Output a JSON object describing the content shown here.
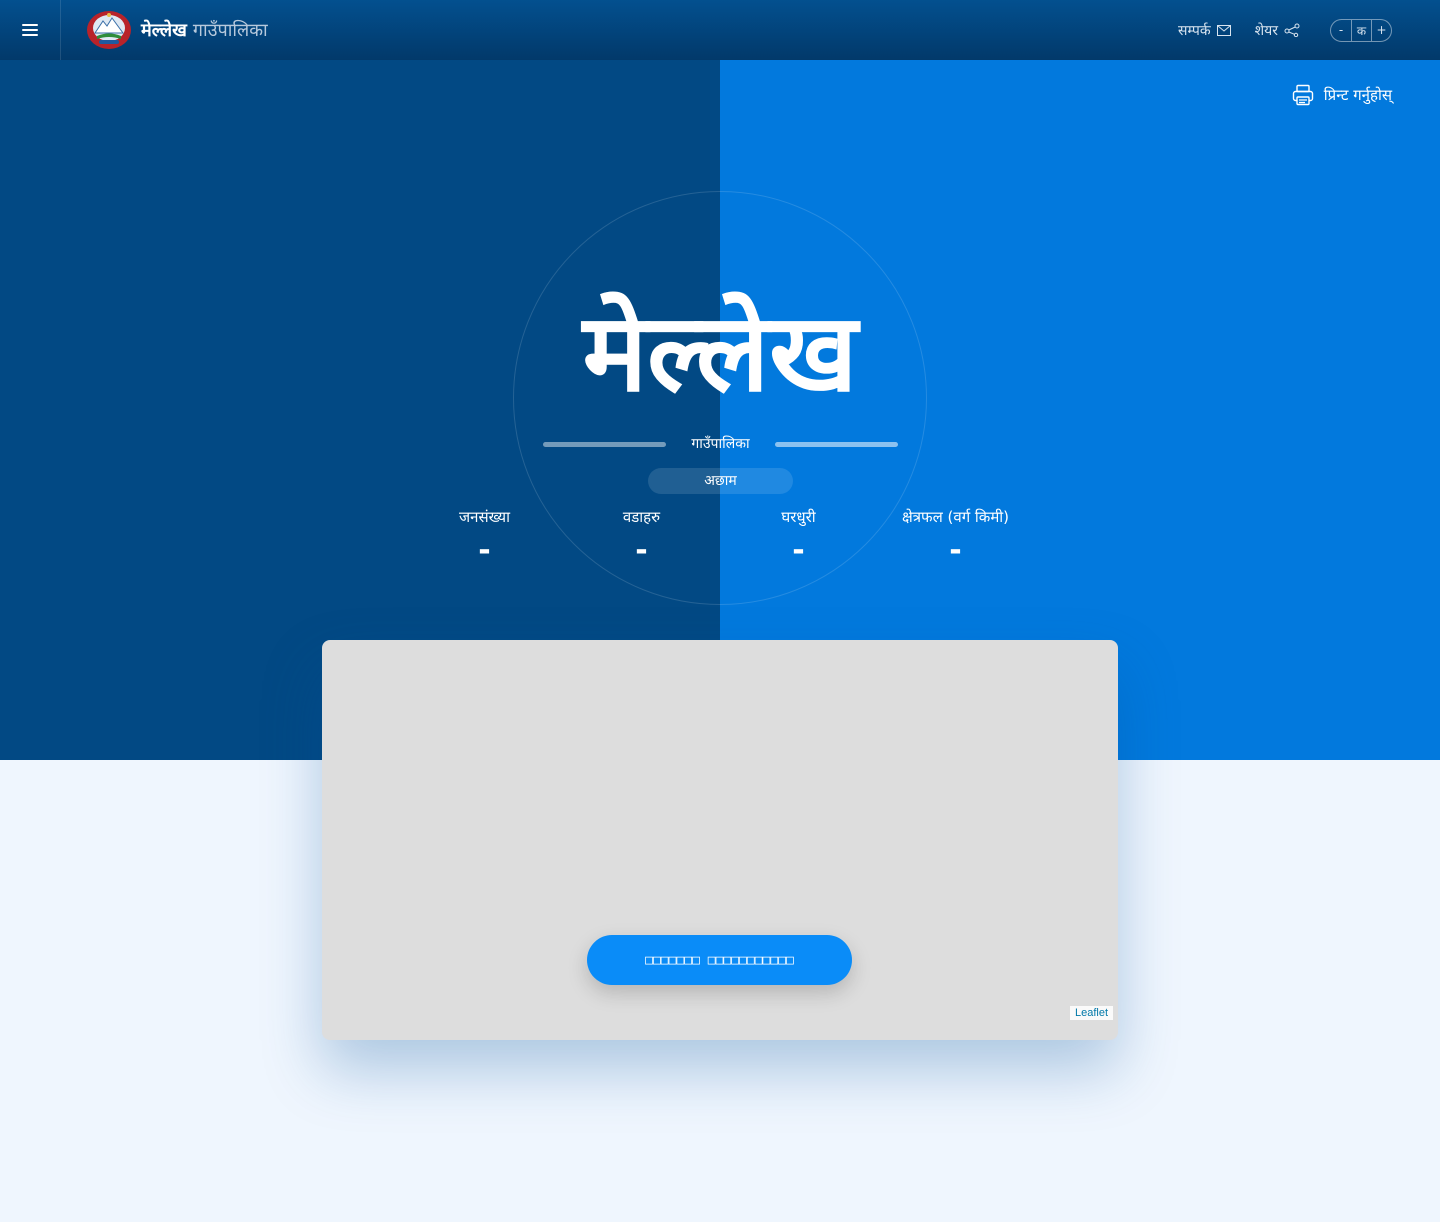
{
  "header": {
    "menu_icon": "hamburger-menu-icon",
    "brand_name": "मेल्लेख",
    "brand_type": "गाउँपालिका",
    "contact_label": "सम्पर्क",
    "share_label": "शेयर",
    "font_decrease": "-",
    "font_reset": "क",
    "font_increase": "+"
  },
  "hero": {
    "print_label": "प्रिन्ट गर्नुहोस्",
    "title": "मेल्लेख",
    "subtitle": "गाउँपालिका",
    "district": "अछाम",
    "stats": [
      {
        "label": "जनसंख्या",
        "value": "-"
      },
      {
        "label": "वडाहरु",
        "value": "-"
      },
      {
        "label": "घरधुरी",
        "value": "-"
      },
      {
        "label": "क्षेत्रफल (वर्ग किमी)",
        "value": "-"
      }
    ]
  },
  "map": {
    "button_label": "□□□□□□□ □□□□□□□□□□□",
    "attribution": "Leaflet"
  },
  "colors": {
    "topbar": "#024a86",
    "hero_left": "#024984",
    "hero_right": "#0279dd",
    "page_bg": "#eff6fe",
    "map_button": "#0a8cf8"
  }
}
